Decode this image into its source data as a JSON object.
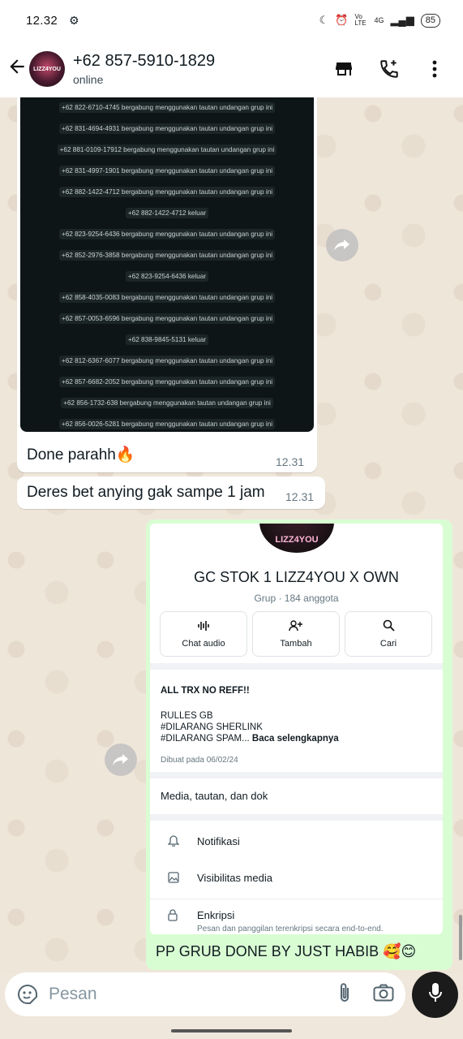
{
  "status_bar": {
    "time": "12.32",
    "network": "4G",
    "volte": "Vo LTE",
    "battery": "85"
  },
  "header": {
    "contact_name": "+62 857-5910-1829",
    "status": "online",
    "avatar_text": "LIZZ4YOU"
  },
  "messages": {
    "image_log_lines": [
      "+62 822-6710-4745 bergabung menggunakan tautan undangan grup ini",
      "+62 831-4694-4931 bergabung menggunakan tautan undangan grup ini",
      "+62 881-0109-17912 bergabung menggunakan tautan undangan grup ini",
      "+62 831-4997-1901 bergabung menggunakan tautan undangan grup ini",
      "+62 882-1422-4712 bergabung menggunakan tautan undangan grup ini",
      "+62 882-1422-4712 keluar",
      "+62 823-9254-6436 bergabung menggunakan tautan undangan grup ini",
      "+62 852-2976-3858 bergabung menggunakan tautan undangan grup ini",
      "+62 823-9254-6436 keluar",
      "+62 858-4035-0083 bergabung menggunakan tautan undangan grup ini",
      "+62 857-0053-6596 bergabung menggunakan tautan undangan grup ini",
      "+62 838-9845-5131 keluar",
      "+62 812-6367-6077 bergabung menggunakan tautan undangan grup ini",
      "+62 857-6682-2052 bergabung menggunakan tautan undangan grup ini",
      "+62 856-1732-638 bergabung menggunakan tautan undangan grup ini",
      "+62 856-0026-5281 bergabung menggunakan tautan undangan grup ini"
    ],
    "msg1_text": "Done parahh🔥",
    "msg1_time": "12.31",
    "msg2_text": "Deres bet anying gak sampe 1 jam",
    "msg2_time": "12.31",
    "out_caption": "PP GRUB DONE BY JUST HABIB 🥰😊"
  },
  "group_screenshot": {
    "avatar_text": "LIZZ4YOU",
    "name": "GC STOK 1 LIZZ4YOU X OWN",
    "subtitle": "Grup · 184 anggota",
    "buttons": [
      "Chat audio",
      "Tambah",
      "Cari"
    ],
    "desc_title": "ALL TRX NO REFF!!",
    "desc_line1": "RULLES GB",
    "desc_line2": "#DILARANG SHERLINK",
    "desc_line3": "#DILARANG SPAM...",
    "desc_more": "Baca selengkapnya",
    "created": "Dibuat pada 06/02/24",
    "media_label": "Media, tautan, dan dok",
    "settings": [
      {
        "label": "Notifikasi",
        "sub": ""
      },
      {
        "label": "Visibilitas media",
        "sub": ""
      },
      {
        "label": "Enkripsi",
        "sub": "Pesan dan panggilan terenkripsi secara end-to-end."
      }
    ]
  },
  "input": {
    "placeholder": "Pesan"
  },
  "colors": {
    "outgoing_bubble": "#d9fdd3",
    "incoming_bubble": "#ffffff",
    "mic_button": "#1b1b1b"
  }
}
